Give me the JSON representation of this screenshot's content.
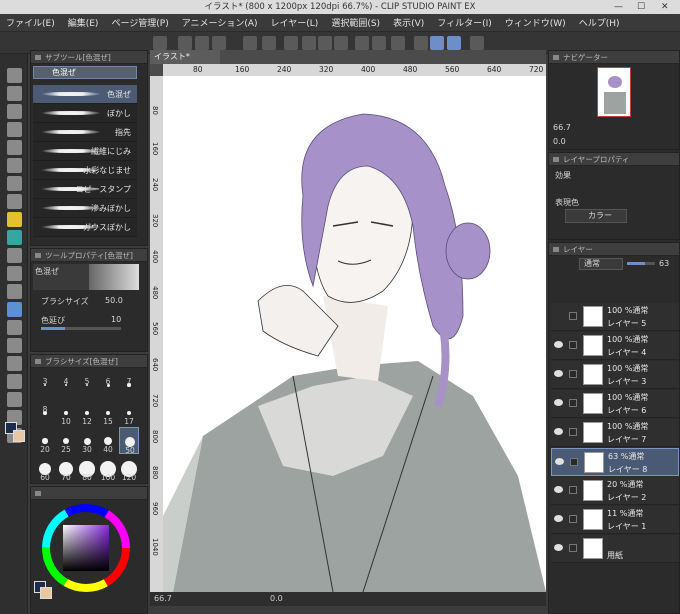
{
  "window": {
    "title": "イラスト* (800 x 1200px 120dpi 66.7%) - CLIP STUDIO PAINT EX",
    "controls": [
      "minimize-icon",
      "maximize-icon",
      "close-icon"
    ]
  },
  "menu": [
    "ファイル(E)",
    "編集(E)",
    "ページ管理(P)",
    "アニメーション(A)",
    "レイヤー(L)",
    "選択範囲(S)",
    "表示(V)",
    "フィルター(I)",
    "ウィンドウ(W)",
    "ヘルプ(H)"
  ],
  "subtool": {
    "header": "サブツール[色混ぜ]",
    "active_group": "色混ぜ",
    "brushes": [
      {
        "label": "色混ぜ",
        "selected": true
      },
      {
        "label": "ぼかし",
        "selected": false
      },
      {
        "label": "指先",
        "selected": false
      },
      {
        "label": "繊維にじみ",
        "selected": false
      },
      {
        "label": "水彩なじませ",
        "selected": false
      },
      {
        "label": "コピースタンプ",
        "selected": false
      },
      {
        "label": "滲みぼかし",
        "selected": false
      },
      {
        "label": "ガウスぼかし",
        "selected": false
      }
    ]
  },
  "tool_property": {
    "header": "ツールプロパティ[色混ぜ]",
    "tool_name": "色混ぜ",
    "brush_size_label": "ブラシサイズ",
    "brush_size_value": "50.0",
    "color_stretch_label": "色延び",
    "color_stretch_value": "10"
  },
  "brush_size_palette": {
    "header": "ブラシサイズ[色混ぜ]",
    "sizes": [
      "3",
      "4",
      "5",
      "6",
      "7",
      "8",
      "10",
      "12",
      "15",
      "17",
      "20",
      "25",
      "30",
      "40",
      "50",
      "60",
      "70",
      "80",
      "100",
      "120"
    ],
    "selected": "50"
  },
  "canvas": {
    "tab": "イラスト*",
    "ruler_ticks": [
      "80",
      "160",
      "240",
      "320",
      "400",
      "480",
      "560",
      "640",
      "720"
    ],
    "ruler_left_ticks": [
      "80",
      "160",
      "240",
      "320",
      "400",
      "480",
      "560",
      "640",
      "720",
      "800",
      "880",
      "960",
      "1040"
    ],
    "zoom": "66.7",
    "rotation": "0.0"
  },
  "navigator": {
    "header": "ナビゲーター",
    "zoom": "66.7",
    "rotation": "0.0"
  },
  "layer_property": {
    "header": "レイヤープロパティ",
    "effect_label": "効果",
    "expression_label": "表現色",
    "expression_value": "カラー"
  },
  "layers_panel": {
    "header": "レイヤー",
    "blend_mode": "通常",
    "opacity": "63",
    "layers": [
      {
        "mode": "100 %通常",
        "name": "レイヤー 5",
        "selected": false,
        "visible": false
      },
      {
        "mode": "100 %通常",
        "name": "レイヤー 4",
        "selected": false,
        "visible": true
      },
      {
        "mode": "100 %通常",
        "name": "レイヤー 3",
        "selected": false,
        "visible": true
      },
      {
        "mode": "100 %通常",
        "name": "レイヤー 6",
        "selected": false,
        "visible": true
      },
      {
        "mode": "100 %通常",
        "name": "レイヤー 7",
        "selected": false,
        "visible": true
      },
      {
        "mode": "63 %通常",
        "name": "レイヤー 8",
        "selected": true,
        "visible": true
      },
      {
        "mode": "20 %通常",
        "name": "レイヤー 2",
        "selected": false,
        "visible": true
      },
      {
        "mode": "11 %通常",
        "name": "レイヤー 1",
        "selected": false,
        "visible": true
      },
      {
        "mode": "",
        "name": "用紙",
        "selected": false,
        "visible": true
      }
    ]
  },
  "colors": {
    "accent": "#5d8fd6",
    "hair": "#a692c8",
    "main_color": "#1b2d4e",
    "sub_color": "#e8c7a2"
  }
}
